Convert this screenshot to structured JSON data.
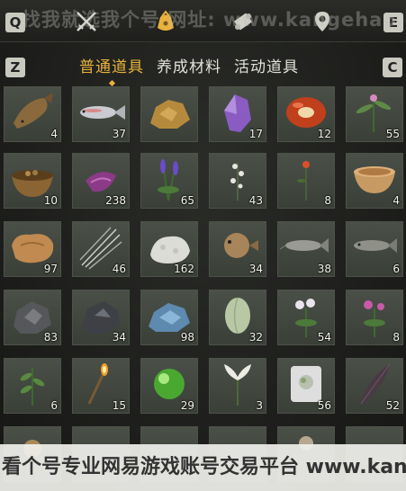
{
  "top_bar": {
    "left_key": "Q",
    "right_key": "E",
    "watermark": "找我就选我个号 网址: www.kangehao.com"
  },
  "tabs": {
    "left_key": "Z",
    "right_key": "C",
    "items": [
      {
        "label": "普通道具",
        "active": true
      },
      {
        "label": "养成材料",
        "active": false
      },
      {
        "label": "活动道具",
        "active": false
      }
    ]
  },
  "accent_color": "#e8b23c",
  "items": [
    {
      "icon": "fish-icon",
      "qty": "4"
    },
    {
      "icon": "salmon-icon",
      "qty": "37"
    },
    {
      "icon": "ore-icon",
      "qty": ""
    },
    {
      "icon": "amethyst-icon",
      "qty": "17"
    },
    {
      "icon": "red-gem-icon",
      "qty": "12"
    },
    {
      "icon": "herb-icon",
      "qty": "55"
    },
    {
      "icon": "mortar-icon",
      "qty": "10"
    },
    {
      "icon": "purple-flower-icon",
      "qty": "238"
    },
    {
      "icon": "lavender-icon",
      "qty": "65"
    },
    {
      "icon": "white-flower-icon",
      "qty": "43"
    },
    {
      "icon": "red-flower-icon",
      "qty": "8"
    },
    {
      "icon": "bowl-icon",
      "qty": "4"
    },
    {
      "icon": "leather-icon",
      "qty": "97"
    },
    {
      "icon": "quills-icon",
      "qty": "46"
    },
    {
      "icon": "white-stone-icon",
      "qty": "162"
    },
    {
      "icon": "puffer-fish-icon",
      "qty": "34"
    },
    {
      "icon": "catfish-icon",
      "qty": "38"
    },
    {
      "icon": "grey-fish-icon",
      "qty": "6"
    },
    {
      "icon": "iron-ore-icon",
      "qty": "83"
    },
    {
      "icon": "dark-ore-icon",
      "qty": "34"
    },
    {
      "icon": "blue-ore-icon",
      "qty": "98"
    },
    {
      "icon": "melon-icon",
      "qty": "32"
    },
    {
      "icon": "white-aster-icon",
      "qty": "54"
    },
    {
      "icon": "pink-flower-icon",
      "qty": "8"
    },
    {
      "icon": "sprout-icon",
      "qty": "6"
    },
    {
      "icon": "torch-icon",
      "qty": "15"
    },
    {
      "icon": "green-orb-icon",
      "qty": "29"
    },
    {
      "icon": "lily-icon",
      "qty": "3"
    },
    {
      "icon": "flower-box-icon",
      "qty": "56"
    },
    {
      "icon": "feather-icon",
      "qty": "52"
    },
    {
      "icon": "partial-item-icon",
      "qty": ""
    },
    {
      "icon": "partial-item-icon",
      "qty": ""
    },
    {
      "icon": "partial-item-icon",
      "qty": ""
    },
    {
      "icon": "partial-item-icon",
      "qty": ""
    },
    {
      "icon": "partial-item-icon",
      "qty": ""
    },
    {
      "icon": "partial-item-icon",
      "qty": ""
    }
  ],
  "bottom_watermark": "看个号专业网易游戏账号交易平台 www.kangehao.com"
}
